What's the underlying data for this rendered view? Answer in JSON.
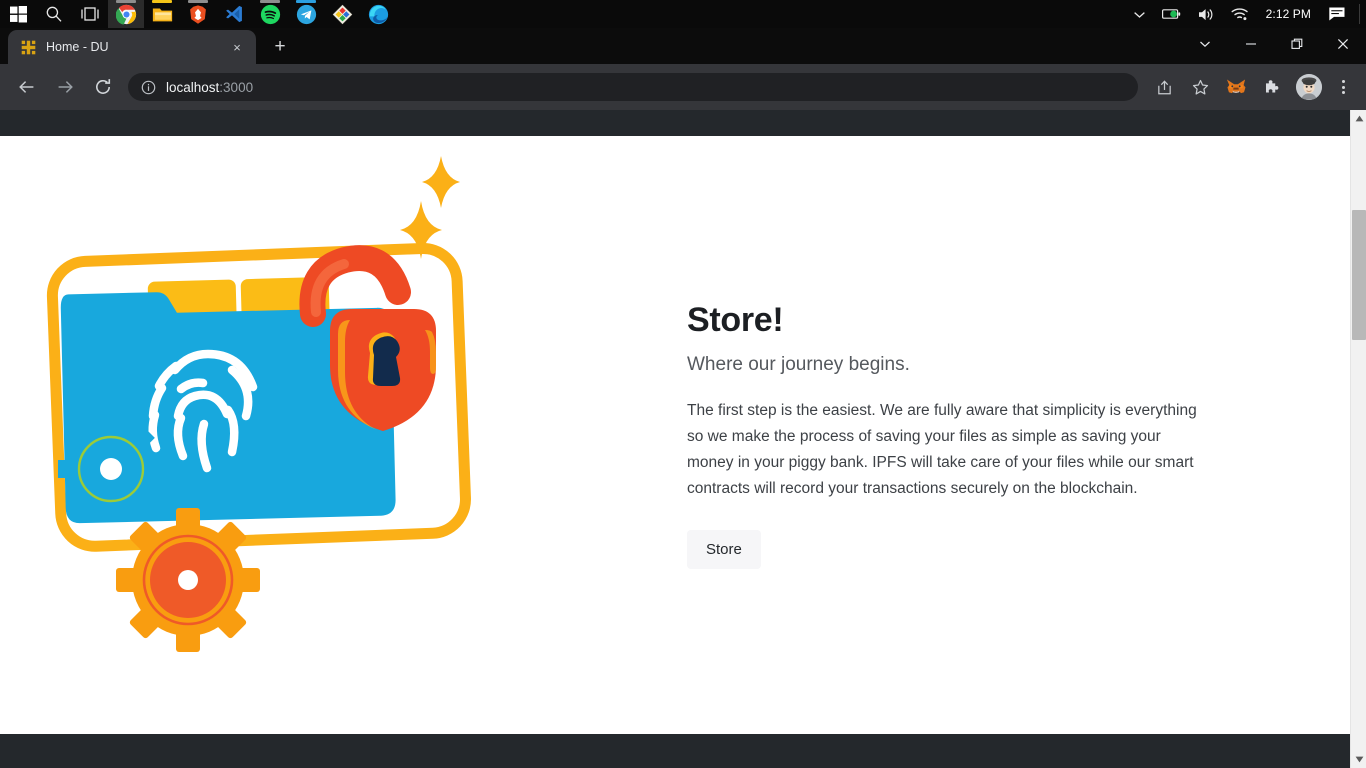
{
  "taskbar": {
    "apps": [
      {
        "name": "start-button",
        "icon": "windows-logo-icon",
        "active": false
      },
      {
        "name": "search-button",
        "icon": "search-icon",
        "active": false
      },
      {
        "name": "task-view-button",
        "icon": "task-view-icon",
        "active": false
      },
      {
        "name": "taskbar-app-chrome",
        "icon": "chrome-icon",
        "active": true
      },
      {
        "name": "taskbar-app-file-explorer",
        "icon": "file-explorer-icon",
        "active": true
      },
      {
        "name": "taskbar-app-brave",
        "icon": "brave-icon",
        "active": true
      },
      {
        "name": "taskbar-app-vscode",
        "icon": "vscode-icon",
        "active": false
      },
      {
        "name": "taskbar-app-spotify",
        "icon": "spotify-icon",
        "active": true
      },
      {
        "name": "taskbar-app-telegram",
        "icon": "telegram-icon",
        "active": true
      },
      {
        "name": "taskbar-app-paint",
        "icon": "paint-icon",
        "active": false
      },
      {
        "name": "taskbar-app-edge",
        "icon": "edge-icon",
        "active": false
      }
    ],
    "tray": {
      "show_hidden_label": "show-hidden-icons",
      "battery_label": "battery-icon",
      "volume_label": "volume-icon",
      "network_label": "wifi-icon",
      "clock": "2:12 PM",
      "notifications_label": "notification-center-icon"
    }
  },
  "browser": {
    "tab": {
      "title": "Home - DU",
      "favicon": "du-site-icon",
      "close_label": "×"
    },
    "new_tab_label": "+",
    "window_controls": {
      "tab_search_label": "tab-search",
      "minimize_label": "minimize",
      "maximize_label": "maximize",
      "close_label": "close"
    },
    "toolbar": {
      "back_label": "back",
      "forward_label": "forward",
      "reload_label": "reload",
      "url_host": "localhost",
      "url_path": ":3000",
      "site_info_label": "site-information",
      "share_label": "share",
      "bookmark_label": "bookmark-star",
      "metamask_label": "metamask-extension",
      "extensions_label": "extensions",
      "profile_label": "profile-avatar",
      "menu_label": "chrome-menu"
    }
  },
  "page": {
    "title": "Store!",
    "subtitle": "Where our journey begins.",
    "body": "The first step is the easiest. We are fully aware that simplicity is everything so we make the process of saving your files as simple as saving your money in your piggy bank. IPFS will take care of your files while our smart contracts will record your transactions securely on the blockchain.",
    "cta_label": "Store",
    "illustration": "secure-storage-illustration"
  },
  "colors": {
    "navbar": "#24282c",
    "footer": "#24282c",
    "card_blue": "#18a8dd",
    "frame_yellow": "#fbb017",
    "tab_yellow": "#fbbc16",
    "lock_red": "#ee4a24",
    "lock_keyhole": "#122b4c",
    "gear_orange": "#f99d10",
    "gear_inner_red": "#ef5a28",
    "gear_blue": "#18a8dd",
    "button_bg": "#f6f6f8",
    "heading": "#1c1f23",
    "subtitle": "#55595e",
    "body_text": "#3d4146"
  }
}
